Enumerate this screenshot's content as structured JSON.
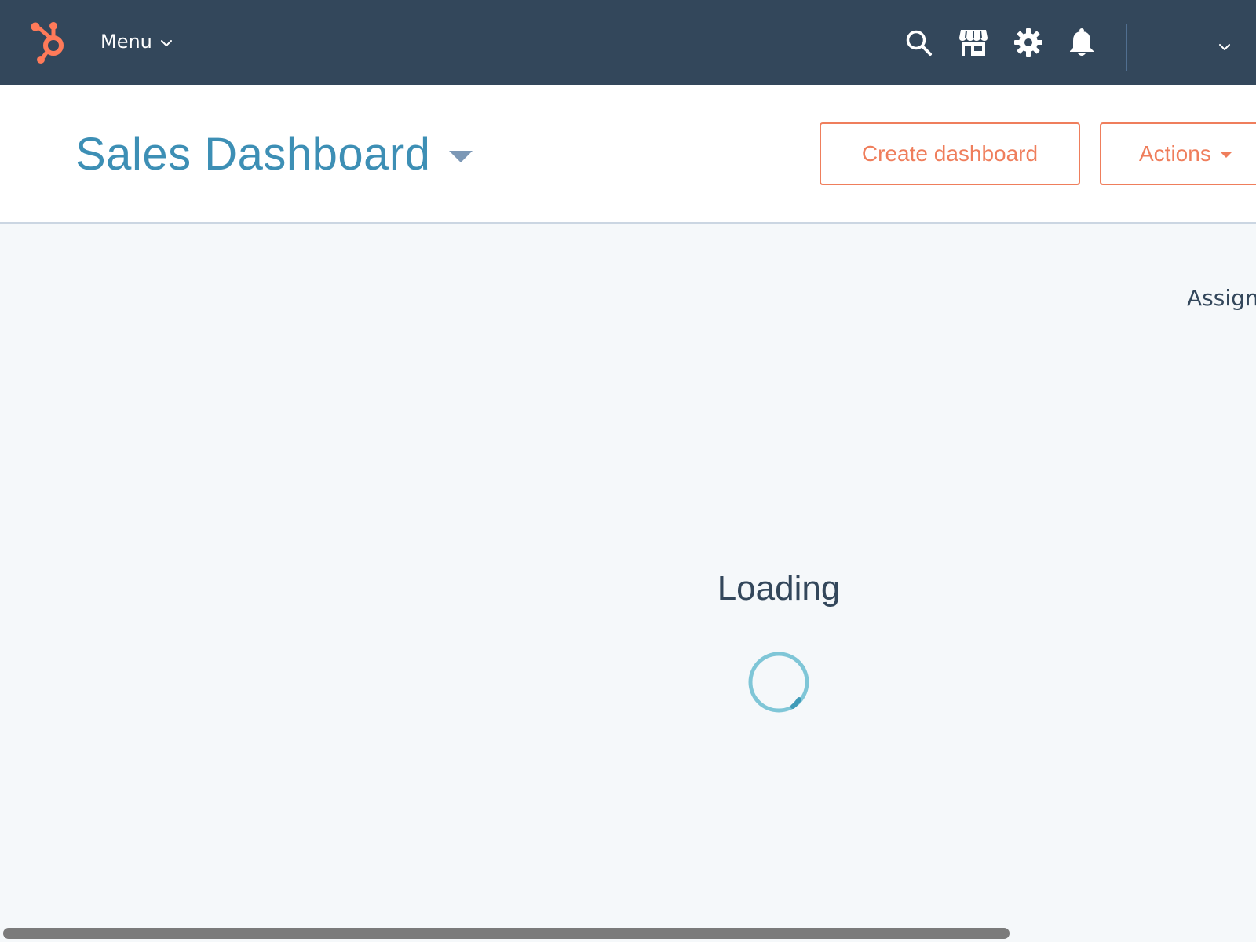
{
  "colors": {
    "nav_background": "#33475b",
    "brand_orange": "#ff7a59",
    "title_blue": "#3d8fb5",
    "button_orange": "#ef7e5c",
    "content_background": "#f5f8fa",
    "spinner": "#7fc6d7"
  },
  "topnav": {
    "logo_icon": "hubspot-sprocket-logo",
    "menu_label": "Menu",
    "icons": [
      "search-icon",
      "marketplace-icon",
      "settings-gear-icon",
      "notifications-bell-icon"
    ]
  },
  "header": {
    "title": "Sales Dashboard",
    "create_button": "Create dashboard",
    "actions_button": "Actions"
  },
  "content": {
    "assign_label": "Assign",
    "loading_text": "Loading"
  }
}
